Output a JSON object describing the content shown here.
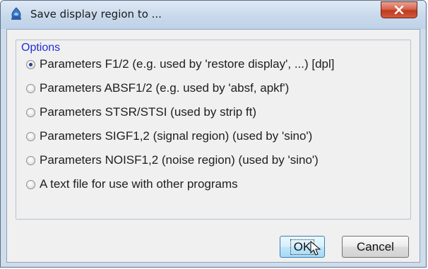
{
  "window": {
    "title": "Save display region to ...",
    "close_icon": "close-icon"
  },
  "options": {
    "group_label": "Options",
    "selected_index": 0,
    "items": [
      {
        "label": "Parameters F1/2 (e.g. used by 'restore display', ...) [dpl]",
        "checked": true
      },
      {
        "label": "Parameters ABSF1/2 (e.g. used by 'absf, apkf')",
        "checked": false
      },
      {
        "label": "Parameters STSR/STSI (used by strip ft)",
        "checked": false
      },
      {
        "label": "Parameters SIGF1,2 (signal region) (used by 'sino')",
        "checked": false
      },
      {
        "label": "Parameters NOISF1,2 (noise region) (used by 'sino')",
        "checked": false
      },
      {
        "label": "A text file for use with other programs",
        "checked": false
      }
    ]
  },
  "buttons": {
    "ok_label": "OK",
    "cancel_label": "Cancel"
  },
  "colors": {
    "accent_label": "#1f2fd6",
    "close_button": "#c0391e"
  }
}
